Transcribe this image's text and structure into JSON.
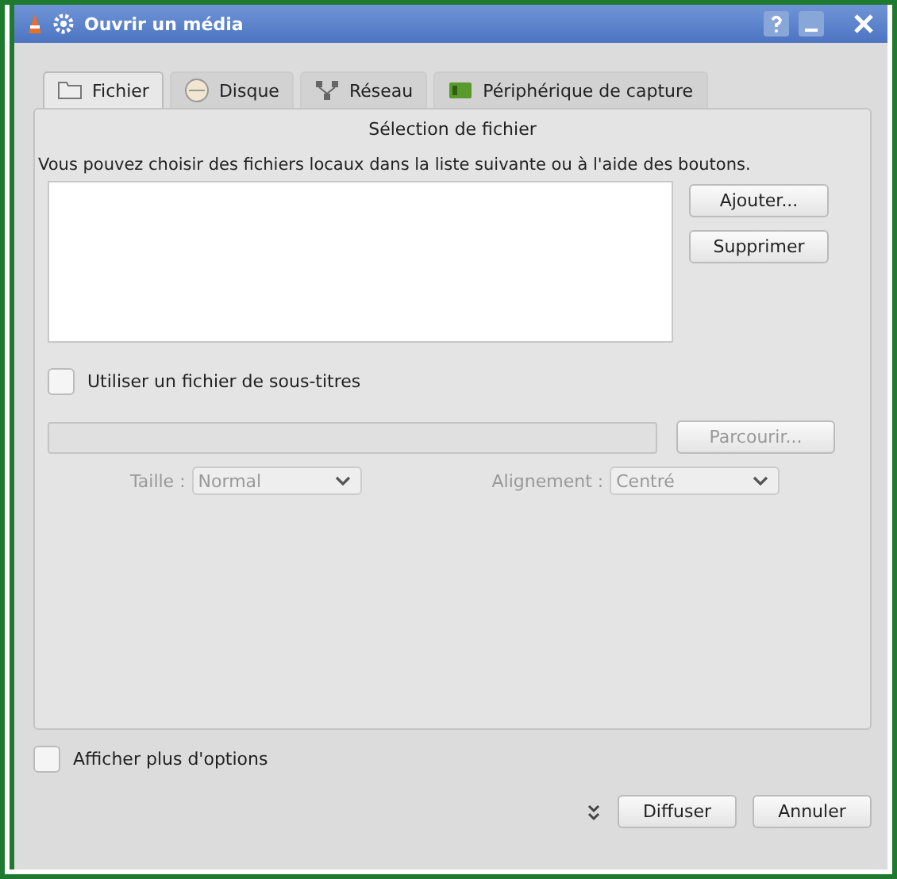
{
  "window": {
    "title": "Ouvrir un média"
  },
  "tabs": [
    {
      "label": "Fichier",
      "selected": true,
      "kind": "file"
    },
    {
      "label": "Disque",
      "selected": false,
      "kind": "disc"
    },
    {
      "label": "Réseau",
      "selected": false,
      "kind": "network"
    },
    {
      "label": "Périphérique de capture",
      "selected": false,
      "kind": "capture"
    }
  ],
  "file_selection": {
    "title": "Sélection de fichier",
    "description": "Vous pouvez choisir des fichiers locaux dans la liste suivante ou à l'aide des boutons.",
    "buttons": [
      "Ajouter...",
      "Supprimer"
    ]
  },
  "subtitles": {
    "label": "Utiliser un fichier de sous-titres",
    "checked": false,
    "disabled": true,
    "browse_button": "Parcourir...",
    "size_label": "Taille :",
    "size_value": "Normal",
    "alignment_label": "Alignement :",
    "alignment_value": "Centré"
  },
  "more_options": {
    "label": "Afficher plus d'options",
    "checked": false
  },
  "buttons": [
    "Diffuser",
    "Annuler"
  ]
}
